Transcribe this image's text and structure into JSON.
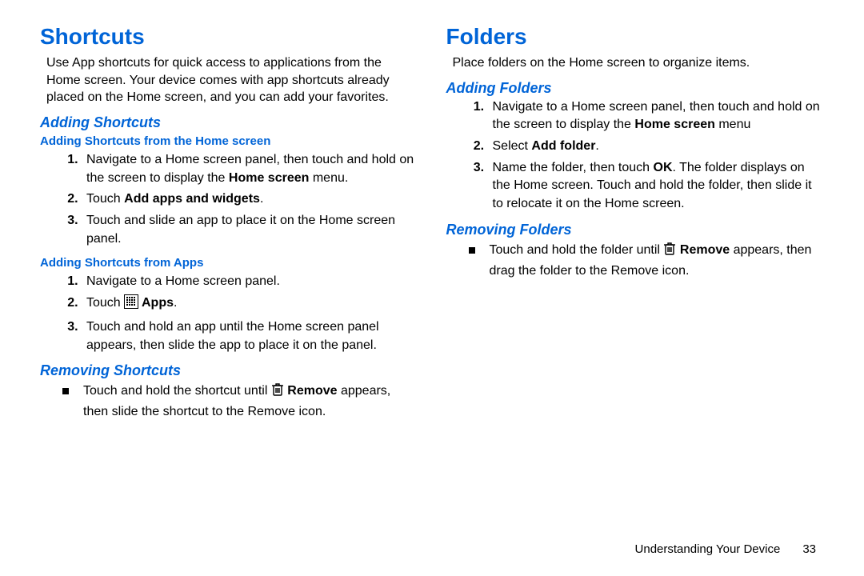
{
  "left": {
    "h1": "Shortcuts",
    "intro": "Use App shortcuts for quick access to applications from the Home screen. Your device comes with app shortcuts already placed on the Home screen, and you can add your favorites.",
    "addingShortcuts": "Adding Shortcuts",
    "addHomeTitle": "Adding Shortcuts from the Home screen",
    "addHome": {
      "s1a": "Navigate to a Home screen panel, then touch and hold on the screen to display the ",
      "s1b": "Home screen",
      "s1c": " menu.",
      "s2a": "Touch ",
      "s2b": "Add apps and widgets",
      "s2c": ".",
      "s3": "Touch and slide an app to place it on the Home screen panel."
    },
    "addAppsTitle": "Adding Shortcuts from Apps",
    "addApps": {
      "s1": "Navigate to a Home screen panel.",
      "s2a": "Touch ",
      "s2b": " Apps",
      "s2c": ".",
      "s3": "Touch and hold an app until the Home screen panel appears, then slide the app to place it on the panel."
    },
    "removingShortcuts": "Removing Shortcuts",
    "removeSc": {
      "a": "Touch and hold the shortcut until ",
      "b": " Remove",
      "c": " appears, then slide the shortcut to the Remove icon."
    }
  },
  "right": {
    "h1": "Folders",
    "intro": "Place folders on the Home screen to organize items.",
    "addingFolders": "Adding Folders",
    "addFolder": {
      "s1a": "Navigate to a Home screen panel, then touch and hold on the screen to display the ",
      "s1b": "Home screen",
      "s1c": " menu",
      "s2a": "Select ",
      "s2b": "Add folder",
      "s2c": ".",
      "s3a": "Name the folder, then touch ",
      "s3b": "OK",
      "s3c": ". The folder displays on the Home screen. Touch and hold the folder, then slide it to relocate it on the Home screen."
    },
    "removingFolders": "Removing Folders",
    "removeFolder": {
      "a": "Touch and hold the folder until ",
      "b": " Remove",
      "c": " appears, then drag the folder to the Remove icon."
    }
  },
  "footer": {
    "section": "Understanding Your Device",
    "page": "33"
  }
}
